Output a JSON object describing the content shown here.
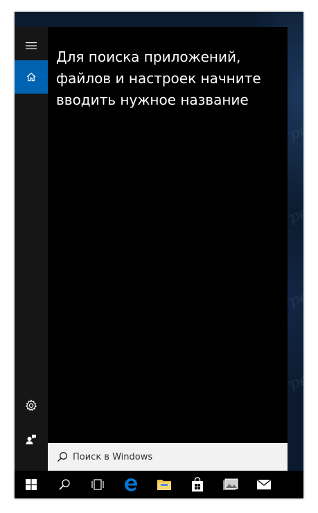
{
  "start_menu": {
    "prompt_text": "Для поиска приложений, файлов и настроек начните вводить нужное название",
    "rail": {
      "menu_icon": "hamburger-menu-icon",
      "home_icon": "home-icon",
      "settings_icon": "gear-icon",
      "feedback_icon": "feedback-person-icon"
    }
  },
  "search": {
    "placeholder": "Поиск в Windows",
    "icon": "search-icon"
  },
  "taskbar": {
    "items": [
      {
        "name": "start-button",
        "icon": "windows-logo-icon"
      },
      {
        "name": "search-button",
        "icon": "search-icon"
      },
      {
        "name": "task-view-button",
        "icon": "task-view-icon"
      },
      {
        "name": "edge-button",
        "icon": "edge-icon"
      },
      {
        "name": "file-explorer-button",
        "icon": "folder-icon"
      },
      {
        "name": "store-button",
        "icon": "store-bag-icon"
      },
      {
        "name": "photos-button",
        "icon": "photos-icon"
      },
      {
        "name": "mail-button",
        "icon": "mail-icon"
      }
    ]
  },
  "colors": {
    "accent": "#0063b1",
    "panel": "#000000",
    "rail": "#161616",
    "edge_blue": "#0078d7",
    "folder_yellow": "#f0c24b"
  }
}
